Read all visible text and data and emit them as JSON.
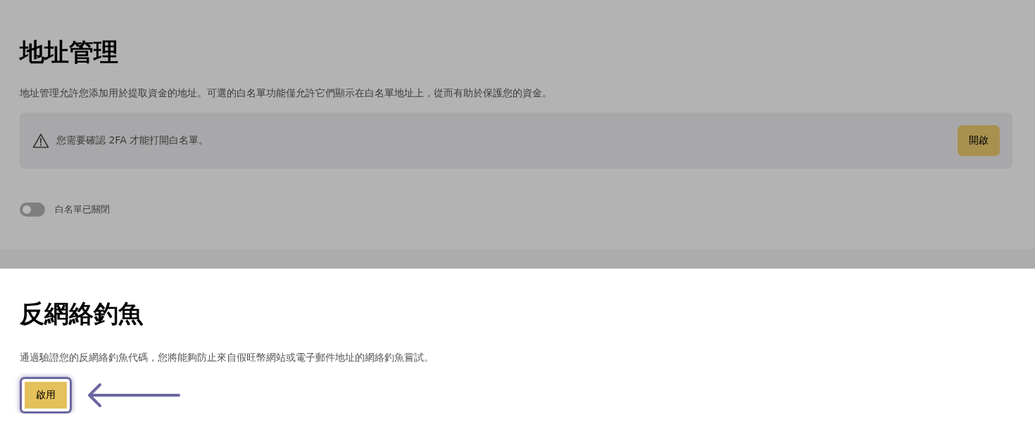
{
  "address_management": {
    "dimmed": true,
    "title": "地址管理",
    "description": "地址管理允許您添加用於提取資金的地址。可選的白名單功能僅允許它們顯示在白名單地址上，從而有助於保護您的資金。",
    "alert": {
      "message": "您需要確認 2FA 才能打開白名單。",
      "button": "開啟"
    },
    "whitelist_toggle": {
      "on": false,
      "label": "白名單已關閉"
    }
  },
  "anti_phishing": {
    "dimmed": false,
    "title": "反網絡釣魚",
    "description": "通過驗證您的反網絡釣魚代碼，您將能夠防止來自假旺幣網站或電子郵件地址的網絡釣魚嘗試。",
    "button": {
      "label": "啟用",
      "highlighted": true
    }
  }
}
